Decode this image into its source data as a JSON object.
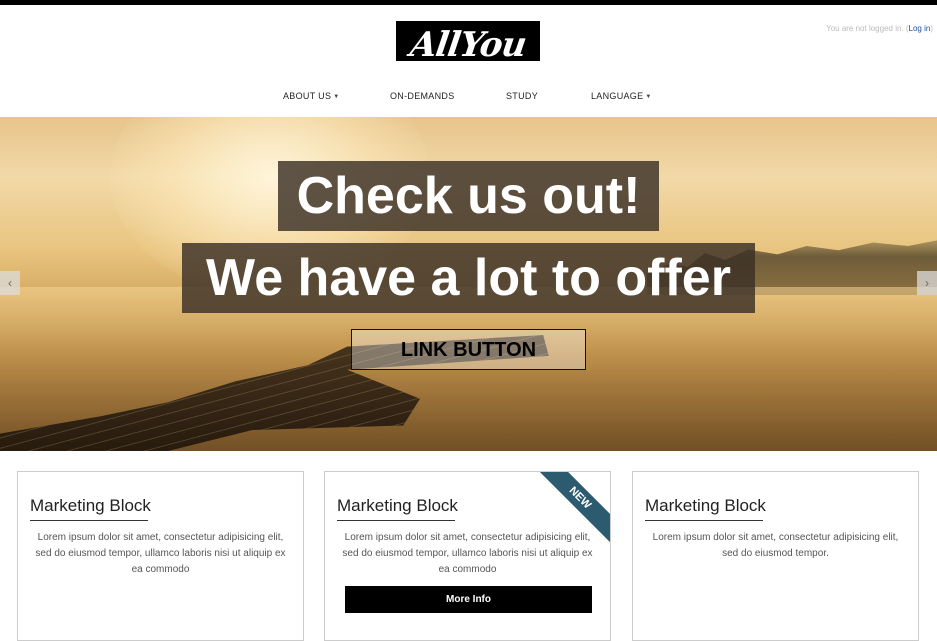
{
  "header": {
    "logo_text": "AllYou",
    "login_status": "You are not logged in. (",
    "login_link": "Log in"
  },
  "nav": {
    "items": [
      {
        "label": "ABOUT US",
        "has_caret": true
      },
      {
        "label": "ON-DEMANDS",
        "has_caret": false
      },
      {
        "label": "STUDY",
        "has_caret": false
      },
      {
        "label": "LANGUAGE",
        "has_caret": true
      }
    ]
  },
  "hero": {
    "heading_1": "Check us out!",
    "heading_2": "We have a lot to offer",
    "button_label": "LINK BUTTON",
    "prev_icon": "chevron-left-icon",
    "next_icon": "chevron-right-icon"
  },
  "blocks": [
    {
      "title": "Marketing Block",
      "text": [
        "Lorem ipsum dolor sit amet, consectetur adipisicing elit,",
        "sed do eiusmod tempor, ullamco laboris nisi ut aliquip ex",
        "ea commodo"
      ]
    },
    {
      "title": "Marketing Block",
      "text": [
        "Lorem ipsum dolor sit amet, consectetur adipisicing elit,",
        "sed do eiusmod tempor, ullamco laboris nisi ut aliquip ex",
        "ea commodo"
      ],
      "ribbon": "NEW",
      "button_label": "More Info"
    },
    {
      "title": "Marketing Block",
      "text": [
        "Lorem ipsum dolor sit amet, consectetur adipisicing elit,",
        "sed do eiusmod tempor."
      ]
    }
  ],
  "colors": {
    "ribbon": "#2c5a6e",
    "login_link": "#1a4fa0",
    "banner_bg": "#3a3026"
  }
}
